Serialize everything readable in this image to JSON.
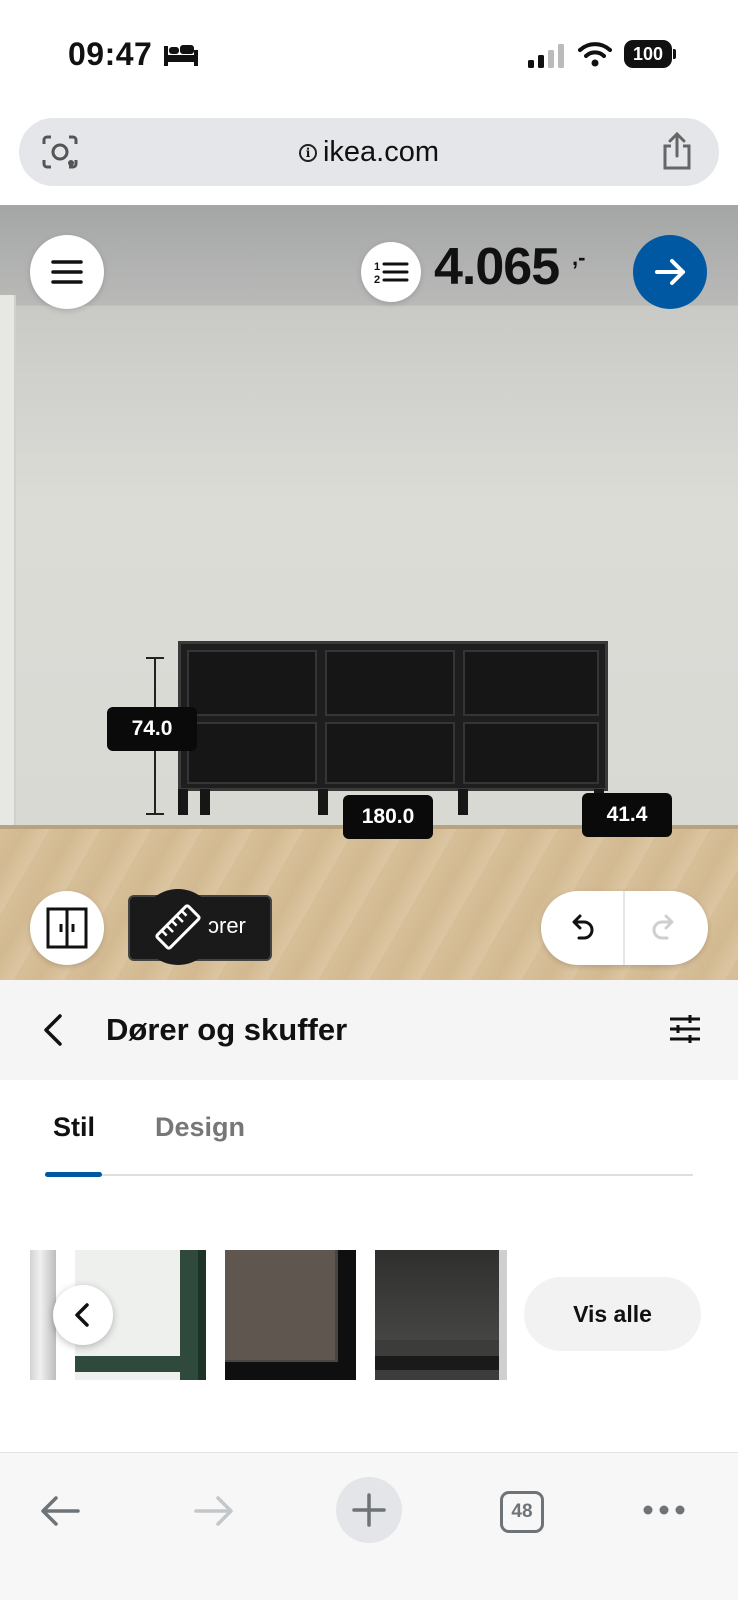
{
  "status_bar": {
    "time": "09:47",
    "battery": "100",
    "icons": [
      "bed-icon",
      "signal-icon",
      "wifi-icon",
      "battery-icon"
    ]
  },
  "browser": {
    "url": "ikea.com",
    "icons": [
      "lens-icon",
      "info-icon",
      "share-icon"
    ]
  },
  "planner": {
    "price": "4.065",
    "price_suffix": ",-",
    "dimensions": {
      "height": "74.0",
      "width": "180.0",
      "depth": "41.4"
    },
    "measure_label": "ɔrer",
    "accent": "#0058a3"
  },
  "panel": {
    "title": "Dører og skuffer",
    "tabs": [
      {
        "label": "Stil",
        "active": true
      },
      {
        "label": "Design",
        "active": false
      }
    ],
    "show_all_label": "Vis alle"
  },
  "toolbar": {
    "tab_count": "48",
    "icons": [
      "back-arrow-icon",
      "forward-arrow-icon",
      "plus-icon",
      "tabs-icon",
      "more-icon"
    ]
  }
}
